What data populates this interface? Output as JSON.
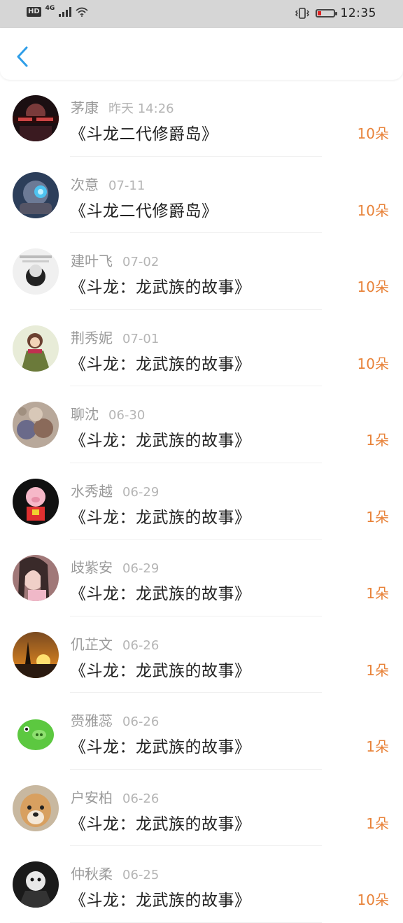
{
  "status_bar": {
    "hd": "HD",
    "network": "4G",
    "time": "12:35"
  },
  "header": {
    "back_icon": "chevron-left-icon",
    "accent_color": "#2f9ee8"
  },
  "records": [
    {
      "name": "茅康",
      "date": "昨天 14:26",
      "title": "《斗龙二代修爵岛》",
      "amount": "10朵"
    },
    {
      "name": "次意",
      "date": "07-11",
      "title": "《斗龙二代修爵岛》",
      "amount": "10朵"
    },
    {
      "name": "建叶飞",
      "date": "07-02",
      "title": "《斗龙：龙武族的故事》",
      "amount": "10朵"
    },
    {
      "name": "荆秀妮",
      "date": "07-01",
      "title": "《斗龙：龙武族的故事》",
      "amount": "10朵"
    },
    {
      "name": "聊沈",
      "date": "06-30",
      "title": "《斗龙：龙武族的故事》",
      "amount": "1朵"
    },
    {
      "name": "水秀越",
      "date": "06-29",
      "title": "《斗龙：龙武族的故事》",
      "amount": "1朵"
    },
    {
      "name": "歧紫安",
      "date": "06-29",
      "title": "《斗龙：龙武族的故事》",
      "amount": "1朵"
    },
    {
      "name": "仉芷文",
      "date": "06-26",
      "title": "《斗龙：龙武族的故事》",
      "amount": "1朵"
    },
    {
      "name": "赍雅蕊",
      "date": "06-26",
      "title": "《斗龙：龙武族的故事》",
      "amount": "1朵"
    },
    {
      "name": "户安柏",
      "date": "06-26",
      "title": "《斗龙：龙武族的故事》",
      "amount": "1朵"
    },
    {
      "name": "仲秋柔",
      "date": "06-25",
      "title": "《斗龙：龙武族的故事》",
      "amount": "10朵"
    }
  ],
  "colors": {
    "name": "#9a9a9a",
    "date": "#b5b5b5",
    "title": "#222222",
    "amount": "#e8833a"
  }
}
